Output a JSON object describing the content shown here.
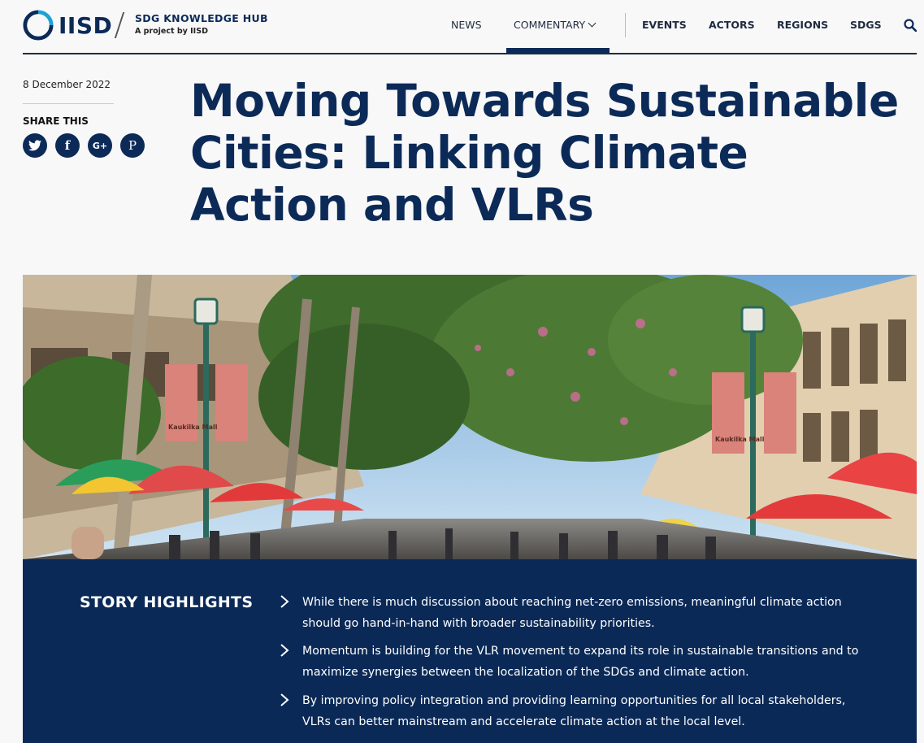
{
  "header": {
    "logo_text": "IISD",
    "hub_title": "SDG KNOWLEDGE HUB",
    "hub_subtitle": "A project by IISD",
    "nav": [
      {
        "label": "NEWS"
      },
      {
        "label": "COMMENTARY"
      },
      {
        "label": "EVENTS"
      },
      {
        "label": "ACTORS"
      },
      {
        "label": "REGIONS"
      },
      {
        "label": "SDGS"
      }
    ],
    "active_nav": "COMMENTARY",
    "accent_color": "#0c2a57",
    "logo_ring_color": "#1aa3d6"
  },
  "article": {
    "date": "8 December 2022",
    "share_label": "SHARE THIS",
    "share_buttons": [
      {
        "icon": "twitter-icon"
      },
      {
        "icon": "facebook-icon",
        "glyph": "f"
      },
      {
        "icon": "google-plus-icon",
        "glyph": "G+"
      },
      {
        "icon": "pinterest-icon",
        "glyph": "P"
      }
    ],
    "title": "Moving Towards Sustainable Cities: Linking Climate Action and VLRs",
    "hero_image": {
      "icon": "street-market-photo",
      "banner_text": "Kaukilka Mall"
    }
  },
  "highlights": {
    "title": "STORY HIGHLIGHTS",
    "items": [
      "While there is much discussion about reaching net-zero emissions, meaningful climate action should go hand-in-hand with broader sustainability priorities.",
      "Momentum is building for the VLR movement to expand its role in sustainable transitions and to maximize synergies between the localization of the SDGs and climate action.",
      "By improving policy integration and providing learning opportunities for all local stakeholders, VLRs can better mainstream and accelerate climate action at the local level."
    ],
    "background_color": "#0a2957"
  }
}
